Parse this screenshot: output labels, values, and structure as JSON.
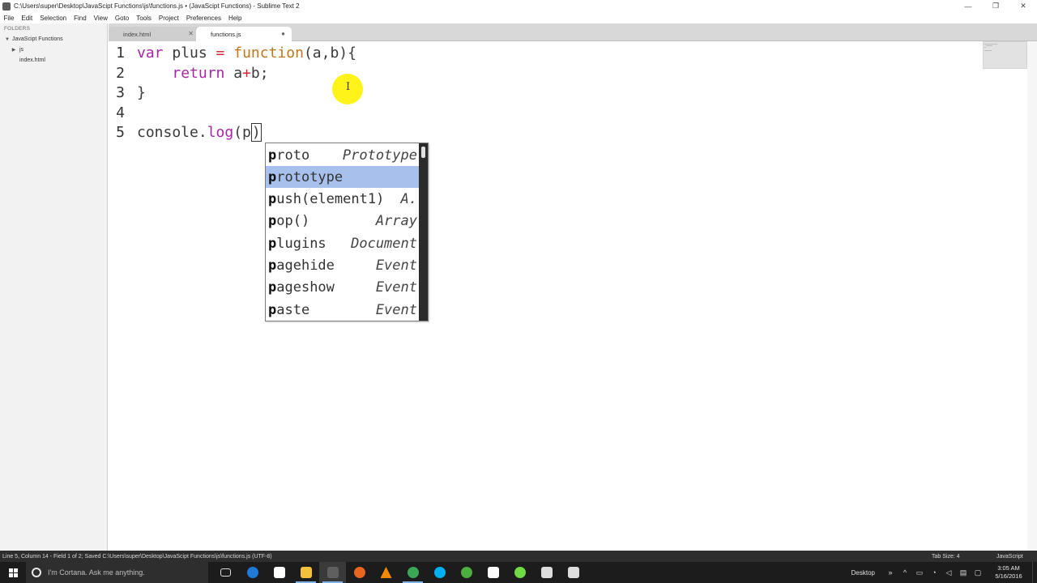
{
  "window": {
    "title": "C:\\Users\\super\\Desktop\\JavaScipt Functions\\js\\functions.js • (JavaScipt Functions) - Sublime Text 2",
    "controls": {
      "minimize": "—",
      "restore": "❐",
      "close": "✕"
    }
  },
  "menu": [
    "File",
    "Edit",
    "Selection",
    "Find",
    "View",
    "Goto",
    "Tools",
    "Project",
    "Preferences",
    "Help"
  ],
  "sidebar": {
    "heading": "FOLDERS",
    "items": [
      {
        "label": "JavaScipt Functions",
        "expanded": true,
        "arrow": "▼"
      },
      {
        "label": "js",
        "expanded": false,
        "arrow": "▶"
      },
      {
        "label": "index.html"
      }
    ]
  },
  "tabs": [
    {
      "label": "index.html",
      "control": "✕",
      "active": false
    },
    {
      "label": "functions.js",
      "control": "●",
      "active": true
    }
  ],
  "editor": {
    "line_numbers": [
      "1",
      "2",
      "3",
      "4",
      "5"
    ],
    "lines": [
      "var plus = function(a,b){",
      "    return a+b;",
      "}",
      "",
      "console.log(p)"
    ]
  },
  "autocomplete": {
    "typed_prefix": "p",
    "selected_index": 1,
    "items": [
      {
        "name": "proto",
        "hint": "Prototype"
      },
      {
        "name": "prototype",
        "hint": ""
      },
      {
        "name": "push(element1)",
        "hint": "A."
      },
      {
        "name": "pop()",
        "hint": "Array"
      },
      {
        "name": "plugins",
        "hint": "Document"
      },
      {
        "name": "pagehide",
        "hint": "Event"
      },
      {
        "name": "pageshow",
        "hint": "Event"
      },
      {
        "name": "paste",
        "hint": "Event"
      }
    ]
  },
  "status": {
    "left": "Line 5, Column 14 - Field 1 of 2; Saved C:\\Users\\super\\Desktop\\JavaScipt Functions\\js\\functions.js (UTF-8)",
    "tab_size": "Tab Size: 4",
    "syntax": "JavaScript"
  },
  "taskbar": {
    "search_placeholder": "I'm Cortana. Ask me anything.",
    "apps": [
      {
        "name": "task-view-icon",
        "color": "#1c1c1c"
      },
      {
        "name": "edge-icon",
        "color": "#1e7ad6"
      },
      {
        "name": "store-icon",
        "color": "#ffffff"
      },
      {
        "name": "file-explorer-icon",
        "color": "#f3c13a"
      },
      {
        "name": "sublime-text-icon",
        "color": "#5f5f5f"
      },
      {
        "name": "firefox-icon",
        "color": "#e8661f"
      },
      {
        "name": "vlc-icon",
        "color": "#f28b00"
      },
      {
        "name": "chrome-icon",
        "color": "#3aa757"
      },
      {
        "name": "skype-icon",
        "color": "#00aff0"
      },
      {
        "name": "utorrent-icon",
        "color": "#4cae3f"
      },
      {
        "name": "slack-icon",
        "color": "#ffffff"
      },
      {
        "name": "upwork-icon",
        "color": "#6fda44"
      },
      {
        "name": "app-icon",
        "color": "#dddddd"
      },
      {
        "name": "paint-icon",
        "color": "#dddddd"
      }
    ],
    "desktop_label": "Desktop",
    "tray_chevron": "»",
    "tray_expand": "^",
    "time": "3:05 AM",
    "date": "5/16/2016"
  }
}
